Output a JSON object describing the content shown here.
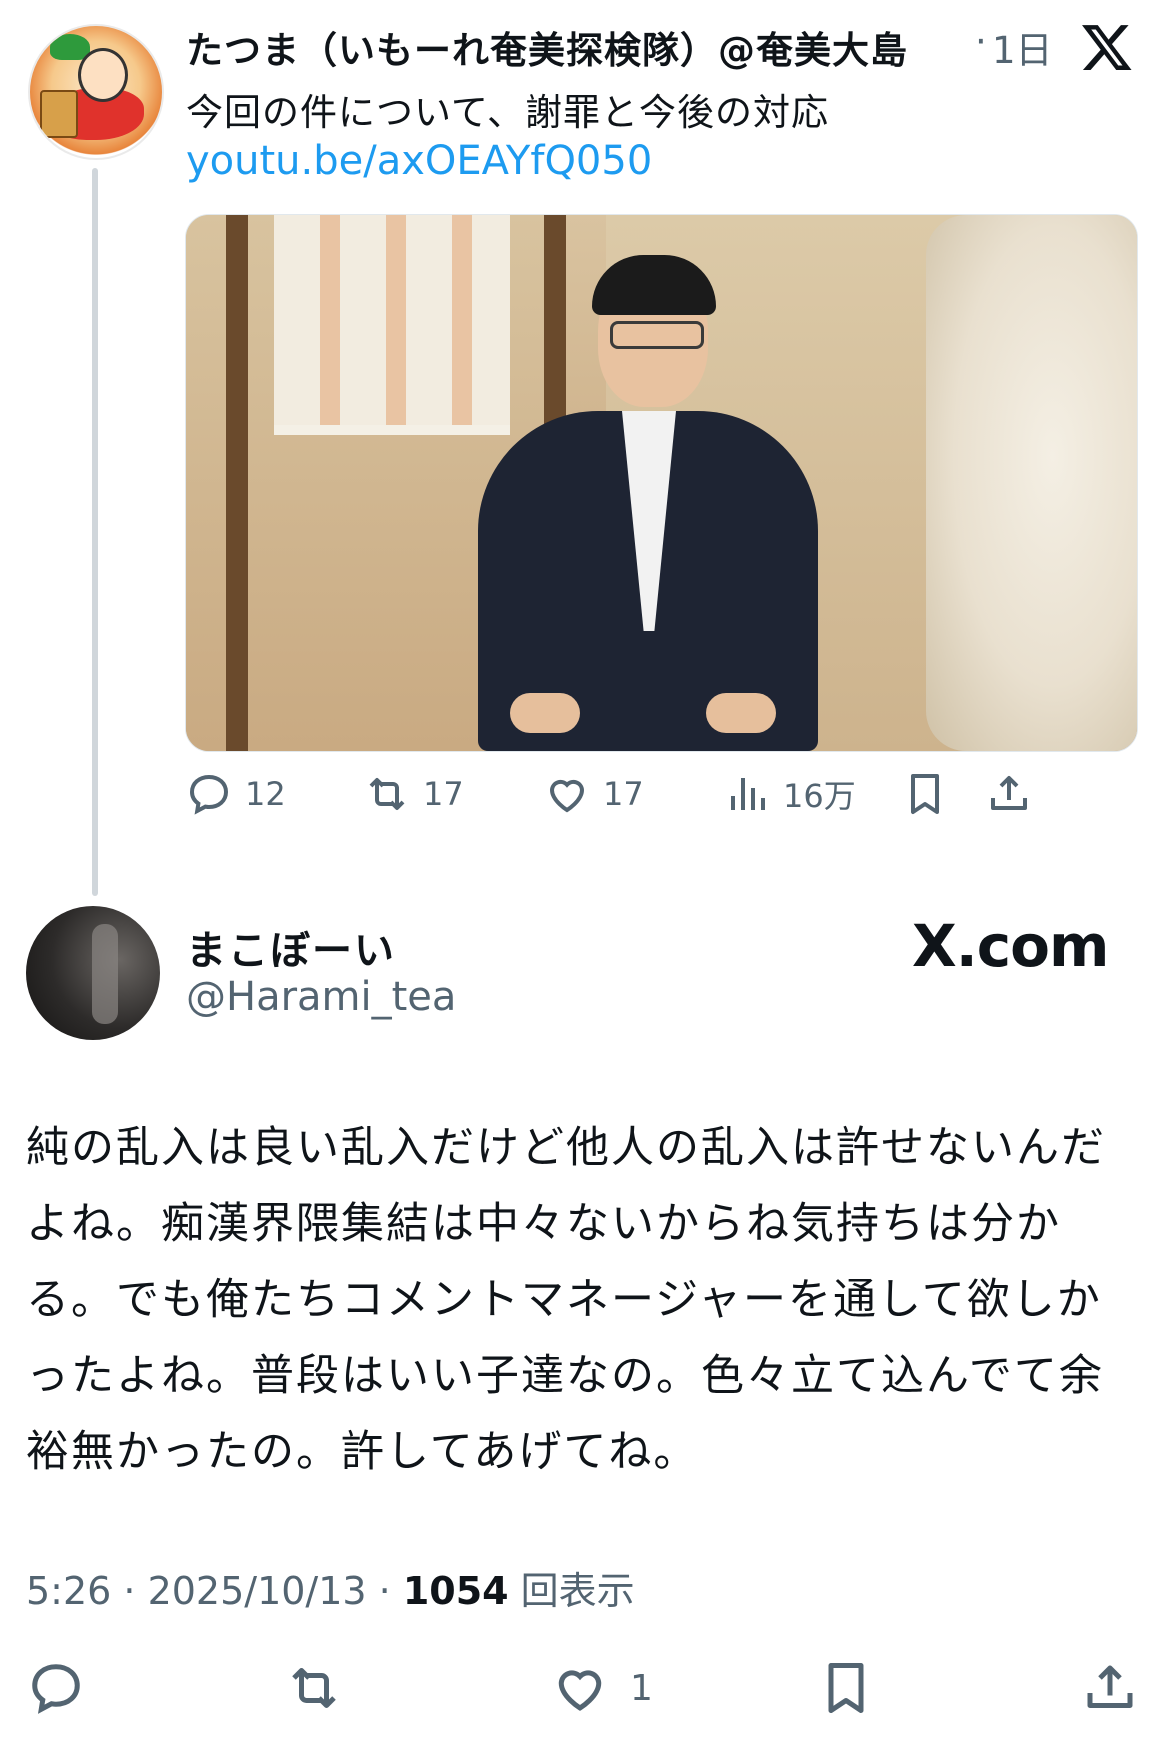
{
  "tweet": {
    "author_name": "たつま（いもーれ奄美探検隊）@奄美大島",
    "separator": "·",
    "time": "1日",
    "text": "今回の件について、謝罪と今後の対応",
    "link": "youtu.be/axOEAYfQ050",
    "stats": {
      "replies": "12",
      "retweets": "17",
      "likes": "17",
      "views": "16万"
    }
  },
  "reply": {
    "author_name": "まこぼーい",
    "handle": "@Harami_tea",
    "site_label": "X.com",
    "text": "純の乱入は良い乱入だけど他人の乱入は許せないんだよね。痴漢界隈集結は中々ないからね気持ちは分かる。でも俺たちコメントマネージャーを通して欲しかったよね。普段はいい子達なの。色々立て込んでて余裕無かったの。許してあげてね。",
    "timestamp": "5:26 · 2025/10/13 · ",
    "views_count": "1054",
    "views_label": " 回表示",
    "likes": "1"
  },
  "icons": {
    "x_logo": "x-logo-icon",
    "reply": "reply-icon",
    "retweet": "retweet-icon",
    "like": "heart-icon",
    "views": "views-icon",
    "bookmark": "bookmark-icon",
    "share": "share-icon"
  },
  "colors": {
    "link": "#1d9bf0",
    "muted": "#536471",
    "text": "#0f1419"
  }
}
